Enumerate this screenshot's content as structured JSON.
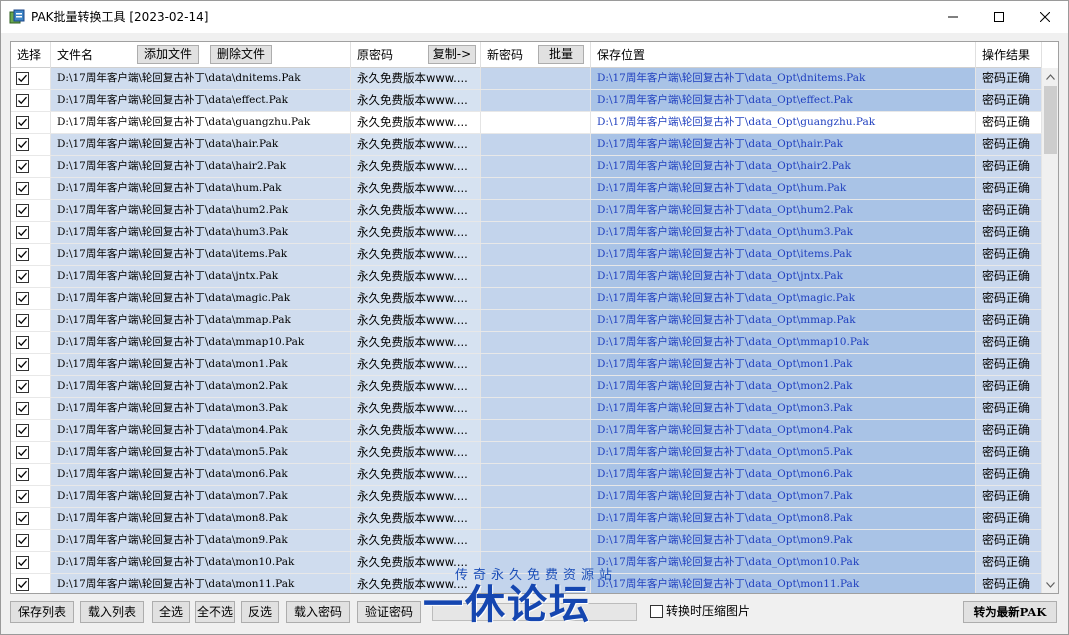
{
  "window": {
    "title": "PAK批量转换工具 [2023-02-14]",
    "icon": "app-icon"
  },
  "header": {
    "col_select": "选择",
    "col_file": "文件名",
    "add_file": "添加文件",
    "delete_file": "删除文件",
    "col_old_pwd": "原密码",
    "copy": "复制->",
    "col_new_pwd": "新密码",
    "batch": "批量",
    "col_save": "保存位置",
    "col_result": "操作结果"
  },
  "rows": [
    {
      "checked": true,
      "file": "D:\\17周年客户端\\轮回复古补丁\\data\\dnitems.Pak",
      "old_pwd": "永久免费版本www....",
      "new_pwd": "",
      "save": "D:\\17周年客户端\\轮回复古补丁\\data_Opt\\dnitems.Pak",
      "result": "密码正确"
    },
    {
      "checked": true,
      "file": "D:\\17周年客户端\\轮回复古补丁\\data\\effect.Pak",
      "old_pwd": "永久免费版本www....",
      "new_pwd": "",
      "save": "D:\\17周年客户端\\轮回复古补丁\\data_Opt\\effect.Pak",
      "result": "密码正确"
    },
    {
      "checked": true,
      "file": "D:\\17周年客户端\\轮回复古补丁\\data\\guangzhu.Pak",
      "old_pwd": "永久免费版本www....",
      "new_pwd": "",
      "save": "D:\\17周年客户端\\轮回复古补丁\\data_Opt\\guangzhu.Pak",
      "result": "密码正确",
      "highlight": true
    },
    {
      "checked": true,
      "file": "D:\\17周年客户端\\轮回复古补丁\\data\\hair.Pak",
      "old_pwd": "永久免费版本www....",
      "new_pwd": "",
      "save": "D:\\17周年客户端\\轮回复古补丁\\data_Opt\\hair.Pak",
      "result": "密码正确"
    },
    {
      "checked": true,
      "file": "D:\\17周年客户端\\轮回复古补丁\\data\\hair2.Pak",
      "old_pwd": "永久免费版本www....",
      "new_pwd": "",
      "save": "D:\\17周年客户端\\轮回复古补丁\\data_Opt\\hair2.Pak",
      "result": "密码正确"
    },
    {
      "checked": true,
      "file": "D:\\17周年客户端\\轮回复古补丁\\data\\hum.Pak",
      "old_pwd": "永久免费版本www....",
      "new_pwd": "",
      "save": "D:\\17周年客户端\\轮回复古补丁\\data_Opt\\hum.Pak",
      "result": "密码正确"
    },
    {
      "checked": true,
      "file": "D:\\17周年客户端\\轮回复古补丁\\data\\hum2.Pak",
      "old_pwd": "永久免费版本www....",
      "new_pwd": "",
      "save": "D:\\17周年客户端\\轮回复古补丁\\data_Opt\\hum2.Pak",
      "result": "密码正确"
    },
    {
      "checked": true,
      "file": "D:\\17周年客户端\\轮回复古补丁\\data\\hum3.Pak",
      "old_pwd": "永久免费版本www....",
      "new_pwd": "",
      "save": "D:\\17周年客户端\\轮回复古补丁\\data_Opt\\hum3.Pak",
      "result": "密码正确"
    },
    {
      "checked": true,
      "file": "D:\\17周年客户端\\轮回复古补丁\\data\\items.Pak",
      "old_pwd": "永久免费版本www....",
      "new_pwd": "",
      "save": "D:\\17周年客户端\\轮回复古补丁\\data_Opt\\items.Pak",
      "result": "密码正确"
    },
    {
      "checked": true,
      "file": "D:\\17周年客户端\\轮回复古补丁\\data\\jntx.Pak",
      "old_pwd": "永久免费版本www....",
      "new_pwd": "",
      "save": "D:\\17周年客户端\\轮回复古补丁\\data_Opt\\jntx.Pak",
      "result": "密码正确"
    },
    {
      "checked": true,
      "file": "D:\\17周年客户端\\轮回复古补丁\\data\\magic.Pak",
      "old_pwd": "永久免费版本www....",
      "new_pwd": "",
      "save": "D:\\17周年客户端\\轮回复古补丁\\data_Opt\\magic.Pak",
      "result": "密码正确"
    },
    {
      "checked": true,
      "file": "D:\\17周年客户端\\轮回复古补丁\\data\\mmap.Pak",
      "old_pwd": "永久免费版本www....",
      "new_pwd": "",
      "save": "D:\\17周年客户端\\轮回复古补丁\\data_Opt\\mmap.Pak",
      "result": "密码正确"
    },
    {
      "checked": true,
      "file": "D:\\17周年客户端\\轮回复古补丁\\data\\mmap10.Pak",
      "old_pwd": "永久免费版本www....",
      "new_pwd": "",
      "save": "D:\\17周年客户端\\轮回复古补丁\\data_Opt\\mmap10.Pak",
      "result": "密码正确"
    },
    {
      "checked": true,
      "file": "D:\\17周年客户端\\轮回复古补丁\\data\\mon1.Pak",
      "old_pwd": "永久免费版本www....",
      "new_pwd": "",
      "save": "D:\\17周年客户端\\轮回复古补丁\\data_Opt\\mon1.Pak",
      "result": "密码正确"
    },
    {
      "checked": true,
      "file": "D:\\17周年客户端\\轮回复古补丁\\data\\mon2.Pak",
      "old_pwd": "永久免费版本www....",
      "new_pwd": "",
      "save": "D:\\17周年客户端\\轮回复古补丁\\data_Opt\\mon2.Pak",
      "result": "密码正确"
    },
    {
      "checked": true,
      "file": "D:\\17周年客户端\\轮回复古补丁\\data\\mon3.Pak",
      "old_pwd": "永久免费版本www....",
      "new_pwd": "",
      "save": "D:\\17周年客户端\\轮回复古补丁\\data_Opt\\mon3.Pak",
      "result": "密码正确"
    },
    {
      "checked": true,
      "file": "D:\\17周年客户端\\轮回复古补丁\\data\\mon4.Pak",
      "old_pwd": "永久免费版本www....",
      "new_pwd": "",
      "save": "D:\\17周年客户端\\轮回复古补丁\\data_Opt\\mon4.Pak",
      "result": "密码正确"
    },
    {
      "checked": true,
      "file": "D:\\17周年客户端\\轮回复古补丁\\data\\mon5.Pak",
      "old_pwd": "永久免费版本www....",
      "new_pwd": "",
      "save": "D:\\17周年客户端\\轮回复古补丁\\data_Opt\\mon5.Pak",
      "result": "密码正确"
    },
    {
      "checked": true,
      "file": "D:\\17周年客户端\\轮回复古补丁\\data\\mon6.Pak",
      "old_pwd": "永久免费版本www....",
      "new_pwd": "",
      "save": "D:\\17周年客户端\\轮回复古补丁\\data_Opt\\mon6.Pak",
      "result": "密码正确"
    },
    {
      "checked": true,
      "file": "D:\\17周年客户端\\轮回复古补丁\\data\\mon7.Pak",
      "old_pwd": "永久免费版本www....",
      "new_pwd": "",
      "save": "D:\\17周年客户端\\轮回复古补丁\\data_Opt\\mon7.Pak",
      "result": "密码正确"
    },
    {
      "checked": true,
      "file": "D:\\17周年客户端\\轮回复古补丁\\data\\mon8.Pak",
      "old_pwd": "永久免费版本www....",
      "new_pwd": "",
      "save": "D:\\17周年客户端\\轮回复古补丁\\data_Opt\\mon8.Pak",
      "result": "密码正确"
    },
    {
      "checked": true,
      "file": "D:\\17周年客户端\\轮回复古补丁\\data\\mon9.Pak",
      "old_pwd": "永久免费版本www....",
      "new_pwd": "",
      "save": "D:\\17周年客户端\\轮回复古补丁\\data_Opt\\mon9.Pak",
      "result": "密码正确"
    },
    {
      "checked": true,
      "file": "D:\\17周年客户端\\轮回复古补丁\\data\\mon10.Pak",
      "old_pwd": "永久免费版本www....",
      "new_pwd": "",
      "save": "D:\\17周年客户端\\轮回复古补丁\\data_Opt\\mon10.Pak",
      "result": "密码正确"
    },
    {
      "checked": true,
      "file": "D:\\17周年客户端\\轮回复古补丁\\data\\mon11.Pak",
      "old_pwd": "永久免费版本www....",
      "new_pwd": "",
      "save": "D:\\17周年客户端\\轮回复古补丁\\data_Opt\\mon11.Pak",
      "result": "密码正确"
    }
  ],
  "bottom": {
    "save_list": "保存列表",
    "load_list": "载入列表",
    "select_all": "全选",
    "select_none": "全不选",
    "invert": "反选",
    "load_pwd": "载入密码",
    "verify_pwd": "验证密码",
    "compress_label": "转换时压缩图片",
    "compress_checked": false,
    "convert": "转为最新PAK"
  },
  "watermark": {
    "line1": "传奇永久免费资源站",
    "line2": "一休论坛"
  },
  "colors": {
    "path_blue": "#1f3fbf",
    "row_fill": "#cfdcee",
    "save_fill": "#a9c3e6"
  }
}
